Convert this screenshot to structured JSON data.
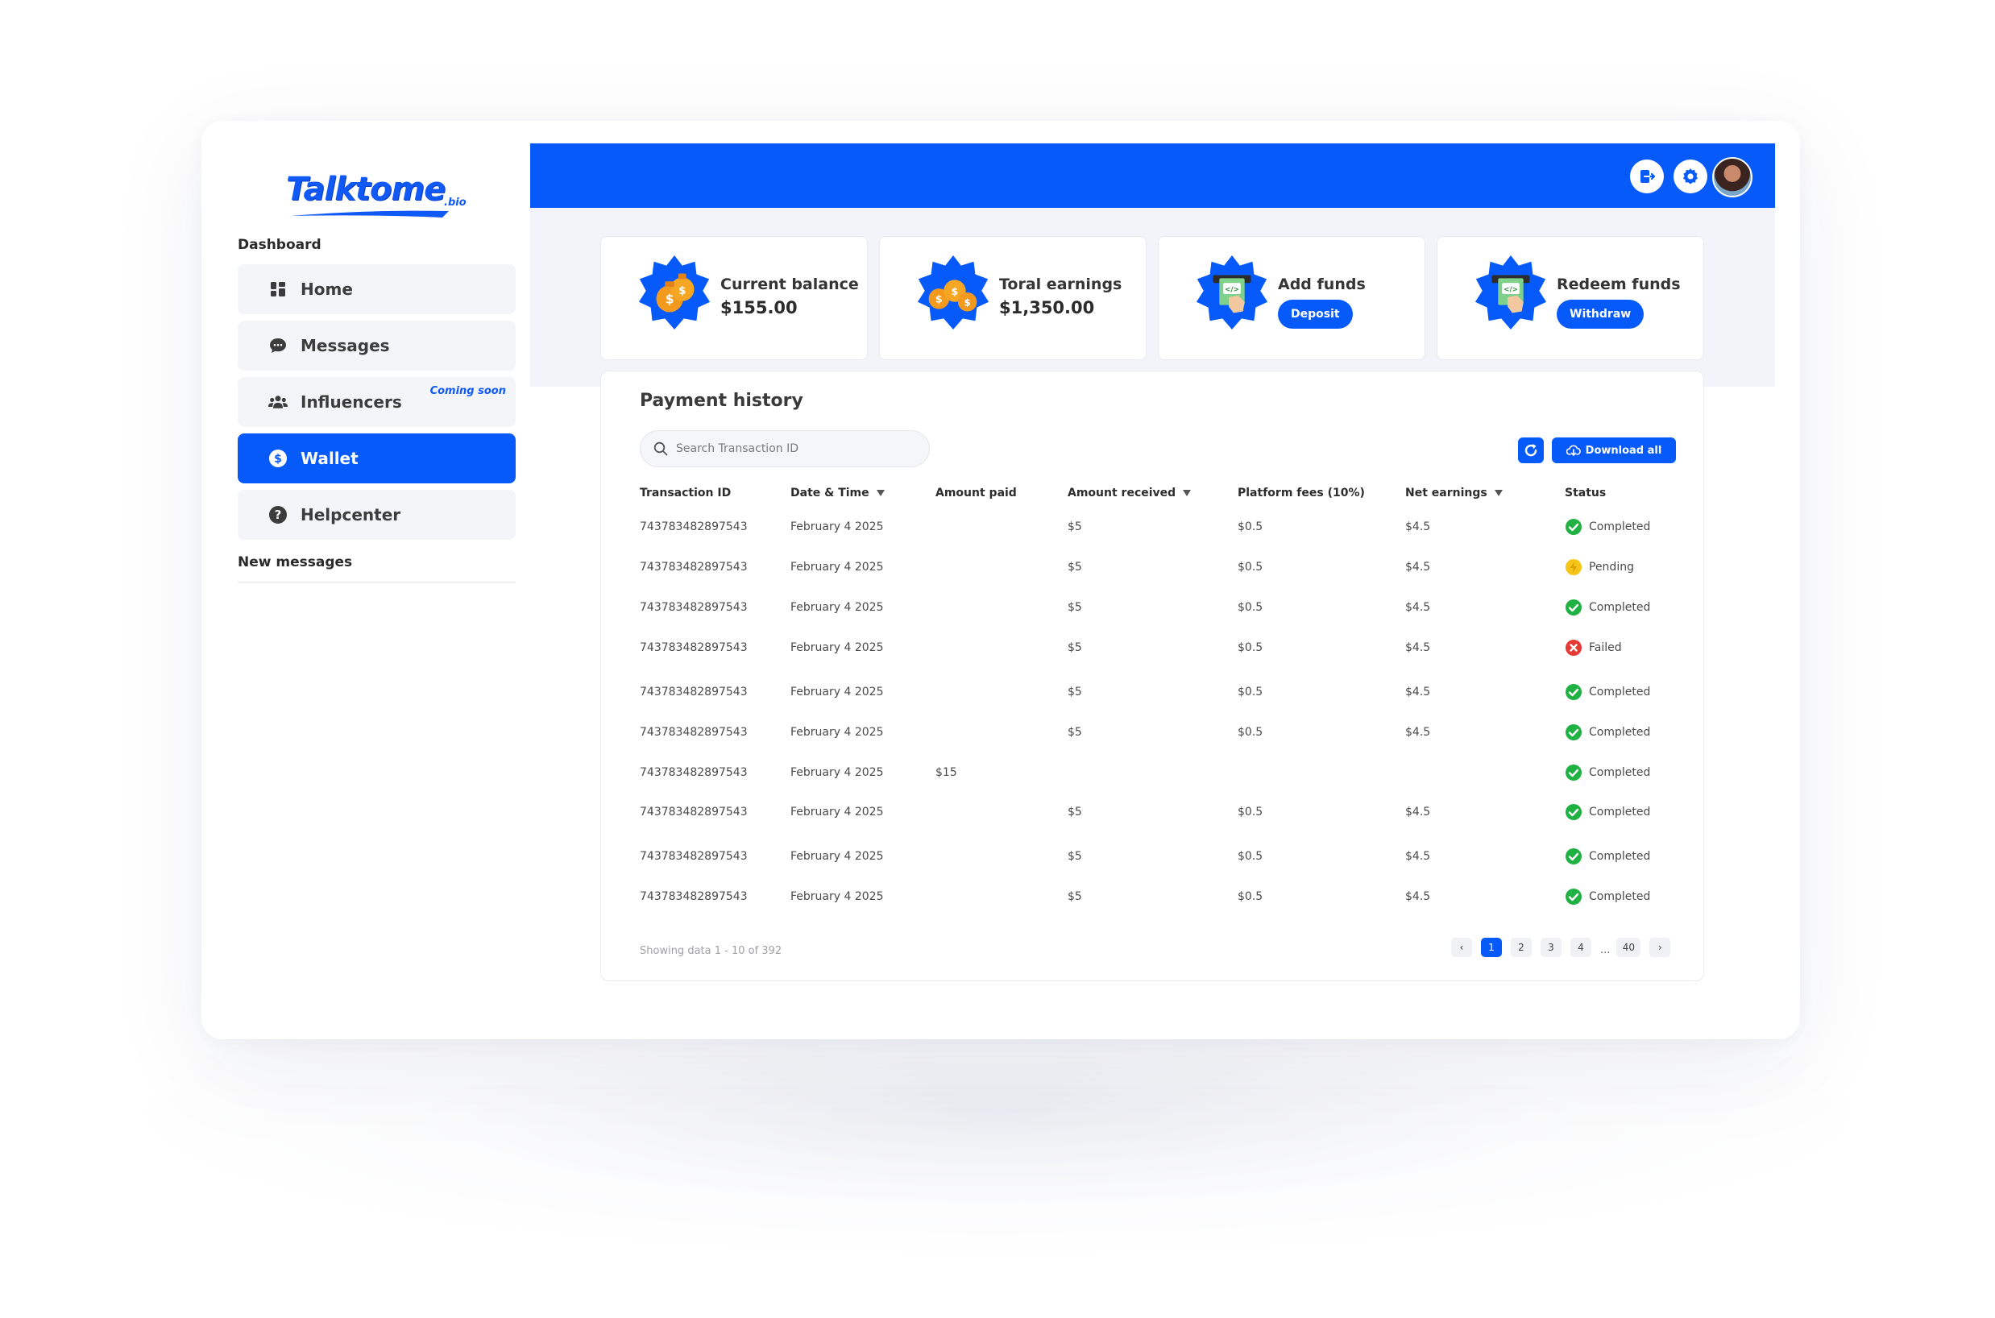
{
  "brand": {
    "name": "Talktome",
    "suffix": ".bio",
    "color": "#1159f5"
  },
  "sidebar": {
    "section_label": "Dashboard",
    "items": [
      {
        "label": "Home",
        "icon": "grid-icon",
        "active": false
      },
      {
        "label": "Messages",
        "icon": "chat-bubble-icon",
        "active": false
      },
      {
        "label": "Influencers",
        "icon": "users-icon",
        "active": false,
        "badge": "Coming soon"
      },
      {
        "label": "Wallet",
        "icon": "dollar-circle-icon",
        "active": true
      },
      {
        "label": "Helpcenter",
        "icon": "question-circle-icon",
        "active": false
      }
    ],
    "new_messages_label": "New messages"
  },
  "topbar": {
    "color": "#065af9",
    "icons": [
      "logout-icon",
      "settings-gear-icon",
      "user-avatar"
    ]
  },
  "cards": [
    {
      "title": "Current balance",
      "value": "$155.00",
      "icon": "money-bags-icon"
    },
    {
      "title": "Toral earnings",
      "value": "$1,350.00",
      "icon": "money-bags-icon"
    },
    {
      "title": "Add funds",
      "button": "Deposit",
      "icon": "atm-cash-icon"
    },
    {
      "title": "Redeem funds",
      "button": "Withdraw",
      "icon": "atm-cash-icon"
    }
  ],
  "payment_history": {
    "title": "Payment history",
    "search_placeholder": "Search Transaction ID",
    "download_label": "Download all",
    "columns": [
      "Transaction ID",
      "Date & Time",
      "Amount paid",
      "Amount received",
      "Platform fees (10%)",
      "Net earnings",
      "Status"
    ],
    "rows": [
      {
        "id": "743783482897543",
        "date": "February 4 2025",
        "paid": "",
        "received": "$5",
        "fees": "$0.5",
        "net": "$4.5",
        "status": "Completed"
      },
      {
        "id": "743783482897543",
        "date": "February 4 2025",
        "paid": "",
        "received": "$5",
        "fees": "$0.5",
        "net": "$4.5",
        "status": "Pending"
      },
      {
        "id": "743783482897543",
        "date": "February 4 2025",
        "paid": "",
        "received": "$5",
        "fees": "$0.5",
        "net": "$4.5",
        "status": "Completed"
      },
      {
        "id": "743783482897543",
        "date": "February 4 2025",
        "paid": "",
        "received": "$5",
        "fees": "$0.5",
        "net": "$4.5",
        "status": "Failed"
      },
      {
        "id": "743783482897543",
        "date": "February 4 2025",
        "paid": "",
        "received": "$5",
        "fees": "$0.5",
        "net": "$4.5",
        "status": "Completed"
      },
      {
        "id": "743783482897543",
        "date": "February 4 2025",
        "paid": "",
        "received": "$5",
        "fees": "$0.5",
        "net": "$4.5",
        "status": "Completed"
      },
      {
        "id": "743783482897543",
        "date": "February 4 2025",
        "paid": "$15",
        "received": "",
        "fees": "",
        "net": "",
        "status": "Completed"
      },
      {
        "id": "743783482897543",
        "date": "February 4 2025",
        "paid": "",
        "received": "$5",
        "fees": "$0.5",
        "net": "$4.5",
        "status": "Completed"
      },
      {
        "id": "743783482897543",
        "date": "February 4 2025",
        "paid": "",
        "received": "$5",
        "fees": "$0.5",
        "net": "$4.5",
        "status": "Completed"
      },
      {
        "id": "743783482897543",
        "date": "February 4 2025",
        "paid": "",
        "received": "$5",
        "fees": "$0.5",
        "net": "$4.5",
        "status": "Completed"
      }
    ],
    "status_colors": {
      "Completed": "#1fb141",
      "Pending": "#f5c518",
      "Failed": "#e53935"
    },
    "showing_text": "Showing data 1 - 10 of  392",
    "pagination": {
      "prev": "‹",
      "pages": [
        "1",
        "2",
        "3",
        "4"
      ],
      "ellipsis": "...",
      "last": "40",
      "next": "›",
      "current": "1"
    }
  }
}
